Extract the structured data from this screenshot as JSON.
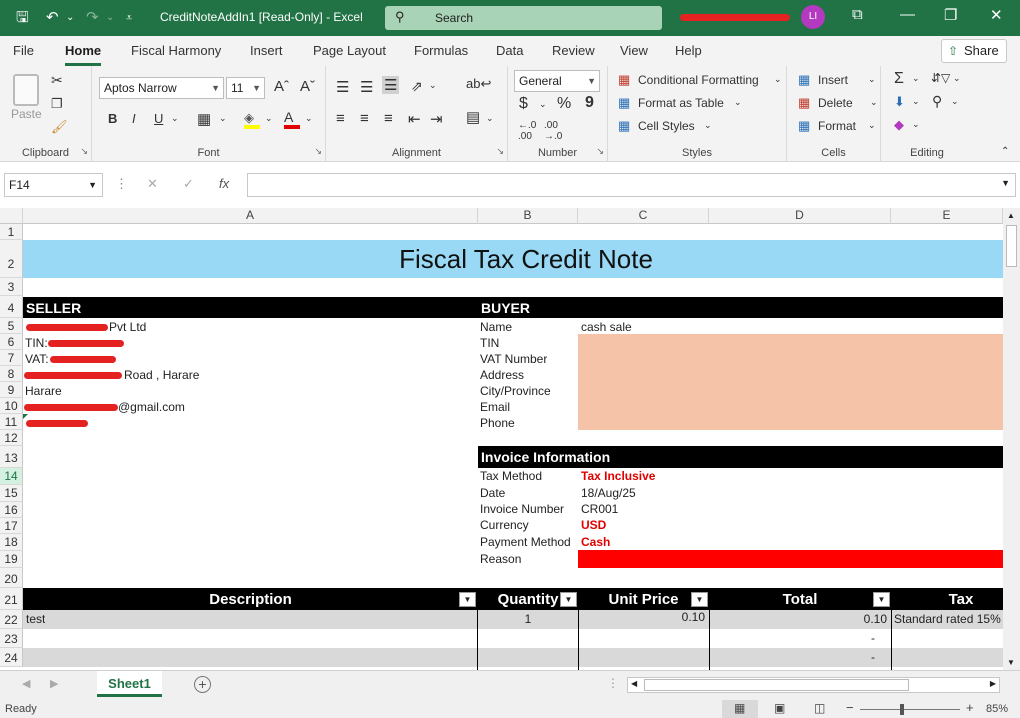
{
  "title_bar": {
    "file_name": "CreditNoteAddIn1 [Read-Only] - Excel",
    "search_placeholder": "Search",
    "avatar_initials": "LI",
    "qat": {
      "save": "🖫",
      "undo": "↶",
      "undo_dd": "⌄",
      "redo": "↷",
      "redo_dd": "⌄",
      "customize": "⩡"
    },
    "win": {
      "ribbon_display": "⧉",
      "minimize": "—",
      "restore": "❐",
      "close": "✕"
    }
  },
  "ribbon_tabs": [
    "File",
    "Home",
    "Fiscal Harmony",
    "Insert",
    "Page Layout",
    "Formulas",
    "Data",
    "Review",
    "View",
    "Help"
  ],
  "share_label": "Share",
  "ribbon": {
    "clipboard": {
      "label": "Clipboard",
      "paste": "Paste"
    },
    "font": {
      "label": "Font",
      "name": "Aptos Narrow",
      "size": "11",
      "bold": "B",
      "italic": "I",
      "underline": "U"
    },
    "alignment": {
      "label": "Alignment"
    },
    "number": {
      "label": "Number",
      "format": "General",
      "currency": "$",
      "percent": "%",
      "comma": "9"
    },
    "styles": {
      "label": "Styles",
      "conditional": "Conditional Formatting",
      "format_table": "Format as Table",
      "cell_styles": "Cell Styles"
    },
    "cells": {
      "label": "Cells",
      "insert": "Insert",
      "delete": "Delete",
      "format": "Format"
    },
    "editing": {
      "label": "Editing"
    }
  },
  "formula_bar": {
    "name_box": "F14",
    "fx": "fx",
    "cancel": "✕",
    "enter": "✓",
    "value": ""
  },
  "columns": [
    "A",
    "B",
    "C",
    "D",
    "E"
  ],
  "rows": [
    "1",
    "2",
    "3",
    "4",
    "5",
    "6",
    "7",
    "8",
    "9",
    "10",
    "11",
    "12",
    "13",
    "14",
    "15",
    "16",
    "17",
    "18",
    "19",
    "20",
    "21",
    "22",
    "23",
    "24"
  ],
  "sheet": {
    "title": "Fiscal Tax Credit Note",
    "seller_header": "SELLER",
    "buyer_header": "BUYER",
    "seller_lines": [
      "Pvt Ltd",
      "TIN:",
      "VAT:",
      "Road , Harare",
      "Harare",
      "@gmail.com"
    ],
    "buyer_labels": [
      "Name",
      "TIN",
      "VAT Number",
      "Address",
      "City/Province",
      "Email",
      "Phone"
    ],
    "buyer_name_value": "cash sale",
    "invoice_header": "Invoice Information",
    "invoice_labels": [
      "Tax Method",
      "Date",
      "Invoice Number",
      "Currency",
      "Payment Method",
      "Reason"
    ],
    "invoice_values": [
      "Tax Inclusive",
      "18/Aug/25",
      "CR001",
      "USD",
      "Cash",
      ""
    ],
    "table_headers": [
      "Description",
      "Quantity",
      "Unit Price",
      "Total",
      "Tax"
    ],
    "table_rows": [
      {
        "description": "test",
        "quantity": "1",
        "unit_price": "0.10",
        "total": "0.10",
        "tax": "Standard rated 15%"
      },
      {
        "description": "",
        "quantity": "",
        "unit_price": "",
        "total": "-",
        "tax": ""
      },
      {
        "description": "",
        "quantity": "",
        "unit_price": "",
        "total": "-",
        "tax": ""
      }
    ]
  },
  "sheet_tabs": [
    "Sheet1"
  ],
  "status": {
    "text": "Ready",
    "zoom": "85%"
  },
  "colors": {
    "excel_green": "#217346",
    "title_fill": "#99d9f5",
    "buyer_fill": "#f4c3a8",
    "accent_red": "#e00000"
  }
}
